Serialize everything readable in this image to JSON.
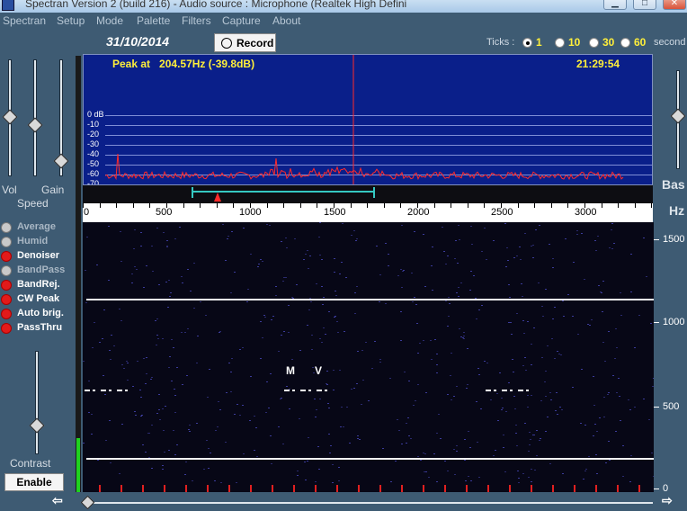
{
  "window": {
    "title": "Spectran Version 2 (build 216) - Audio source : Microphone (Realtek High Defini",
    "minimize": "▁",
    "maximize": "□",
    "close": "✕"
  },
  "menu": [
    "Spectran",
    "Setup",
    "Mode",
    "Palette",
    "Filters",
    "Capture",
    "About"
  ],
  "left_panel": {
    "vol_label": "Vol",
    "gain_label": "Gain",
    "speed_label": "Speed",
    "options": [
      {
        "label": "Average",
        "on": false
      },
      {
        "label": "Humid",
        "on": false
      },
      {
        "label": "Denoiser",
        "on": true
      },
      {
        "label": "BandPass",
        "on": false
      },
      {
        "label": "BandRej.",
        "on": true
      },
      {
        "label": "CW Peak",
        "on": true
      },
      {
        "label": "Auto brig.",
        "on": true
      },
      {
        "label": "PassThru",
        "on": true
      }
    ],
    "contrast_label": "Contrast",
    "enable_button": "Enable"
  },
  "toolbar": {
    "date": "31/10/2014",
    "record_label": "Record",
    "ticks_label": "Ticks :",
    "ticks": [
      {
        "label": "1",
        "selected": true
      },
      {
        "label": "10",
        "selected": false
      },
      {
        "label": "30",
        "selected": false
      },
      {
        "label": "60",
        "selected": false
      }
    ],
    "seconds_label": "second"
  },
  "spectrum": {
    "peak_prefix": "Peak at",
    "peak_value": "204.57Hz (-39.8dB)",
    "clock": "21:29:54",
    "db_labels": [
      "0 dB",
      "-10",
      "-20",
      "-30",
      "-40",
      "-50",
      "-60",
      "-70"
    ],
    "trace_color": "#ff2a2a",
    "background_color": "#0a1f8a"
  },
  "ruler": {
    "labels": [
      "0",
      "500",
      "1000",
      "1500",
      "2000",
      "2500",
      "3000"
    ]
  },
  "waterfall": {
    "hz_labels": [
      "1500",
      "1000",
      "500",
      "0"
    ],
    "markers": [
      "M",
      "V"
    ]
  },
  "right_panel": {
    "base_label": "Bas",
    "hz_label": "Hz"
  }
}
